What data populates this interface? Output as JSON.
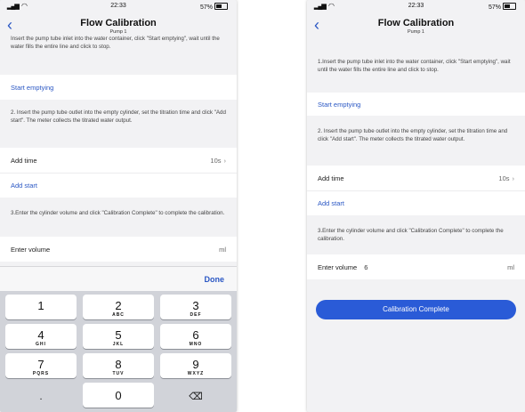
{
  "left": {
    "status": {
      "time": "22:33",
      "battery": "57%"
    },
    "nav": {
      "title": "Flow Calibration",
      "subtitle": "Pump 1"
    },
    "step1_text": "Insert the pump tube inlet into the water container, click \"Start emptying\", wait until the water fills the entire line and click to stop.",
    "start_emptying_label": "Start emptying",
    "step2_text": "2. Insert the pump tube outlet into the empty cylinder, set the titration time and click \"Add start\". The meter collects the titrated water output.",
    "add_time_label": "Add time",
    "add_time_value": "10s",
    "add_start_label": "Add start",
    "step3_text": "3.Enter the cylinder volume and click \"Calibration Complete\" to complete the calibration.",
    "volume_label": "Enter volume",
    "volume_unit": "ml",
    "done_label": "Done",
    "keys": [
      {
        "digit": "1",
        "letters": ""
      },
      {
        "digit": "2",
        "letters": "ABC"
      },
      {
        "digit": "3",
        "letters": "DEF"
      },
      {
        "digit": "4",
        "letters": "GHI"
      },
      {
        "digit": "5",
        "letters": "JKL"
      },
      {
        "digit": "6",
        "letters": "MNO"
      },
      {
        "digit": "7",
        "letters": "PQRS"
      },
      {
        "digit": "8",
        "letters": "TUV"
      },
      {
        "digit": "9",
        "letters": "WXYZ"
      },
      {
        "digit": ".",
        "letters": ""
      },
      {
        "digit": "0",
        "letters": ""
      },
      {
        "digit": "⌫",
        "letters": ""
      }
    ]
  },
  "right": {
    "status": {
      "time": "22:33",
      "battery": "57%"
    },
    "nav": {
      "title": "Flow Calibration",
      "subtitle": "Pump 1"
    },
    "step1_text": "1.Insert the pump tube inlet into the water container, click \"Start emptying\", wait until the water fills the entire line and click to stop.",
    "start_emptying_label": "Start emptying",
    "step2_text": "2. Insert the pump tube outlet into the empty cylinder, set the titration time and click \"Add start\". The meter collects the titrated water output.",
    "add_time_label": "Add time",
    "add_time_value": "10s",
    "add_start_label": "Add start",
    "step3_text": "3.Enter the cylinder volume and click \"Calibration Complete\" to complete the calibration.",
    "volume_label": "Enter volume",
    "volume_value": "6",
    "volume_unit": "ml",
    "complete_label": "Calibration Complete"
  },
  "colors": {
    "accent": "#2a57c4",
    "button": "#2a5bd7",
    "background": "#f2f2f4"
  },
  "icons": {
    "back": "chevron-left-icon",
    "delete": "backspace-icon"
  }
}
